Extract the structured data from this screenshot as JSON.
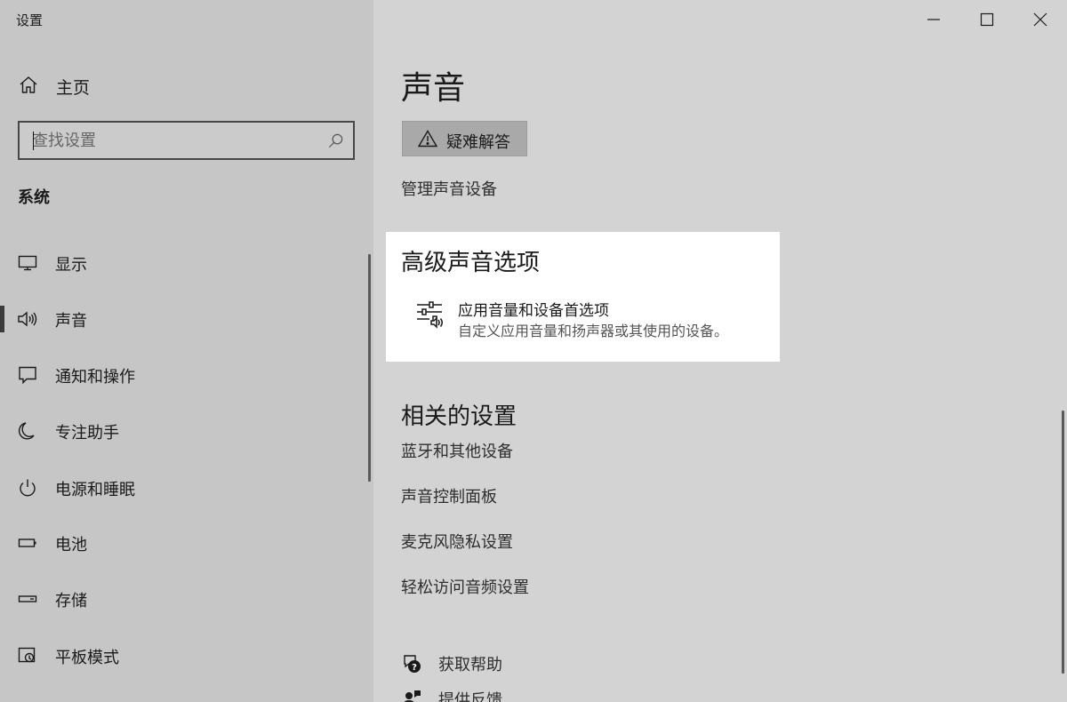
{
  "window": {
    "title": "设置",
    "controls": [
      "minimize",
      "maximize",
      "close"
    ]
  },
  "sidebar": {
    "home_label": "主页",
    "search": {
      "value": "",
      "placeholder": "查找设置"
    },
    "section_title": "系统",
    "items": [
      {
        "label": "显示",
        "icon": "display-icon",
        "selected": false
      },
      {
        "label": "声音",
        "icon": "speaker-icon",
        "selected": true
      },
      {
        "label": "通知和操作",
        "icon": "notification-icon",
        "selected": false
      },
      {
        "label": "专注助手",
        "icon": "moon-icon",
        "selected": false
      },
      {
        "label": "电源和睡眠",
        "icon": "power-icon",
        "selected": false
      },
      {
        "label": "电池",
        "icon": "battery-icon",
        "selected": false
      },
      {
        "label": "存储",
        "icon": "storage-icon",
        "selected": false
      },
      {
        "label": "平板模式",
        "icon": "tablet-mode-icon",
        "selected": false
      }
    ]
  },
  "main": {
    "page_title": "声音",
    "troubleshoot_label": "疑难解答",
    "manage_devices_link": "管理声音设备",
    "advanced": {
      "title": "高级声音选项",
      "item_title": "应用音量和设备首选项",
      "item_desc": "自定义应用音量和扬声器或其使用的设备。"
    },
    "related": {
      "title": "相关的设置",
      "links": [
        "蓝牙和其他设备",
        "声音控制面板",
        "麦克风隐私设置",
        "轻松访问音频设置"
      ]
    },
    "help": {
      "get_help": "获取帮助",
      "feedback": "提供反馈"
    }
  },
  "colors": {
    "sidebar_bg": "#c6c6c6",
    "main_bg": "#d3d3d3",
    "card_bg": "#ffffff",
    "button_bg": "#a9a9a9",
    "selection_bar": "#3b3b3b"
  }
}
